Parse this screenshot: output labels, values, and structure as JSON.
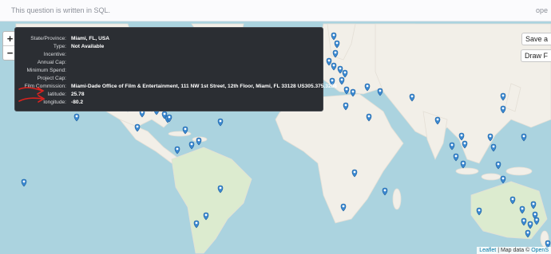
{
  "header": {
    "question_text": "This question is written in SQL.",
    "right_text": "ope"
  },
  "map": {
    "zoom_in_label": "+",
    "zoom_out_label": "−",
    "save_label": "Save a",
    "draw_label": "Draw F",
    "attribution": {
      "leaflet": "Leaflet",
      "separator": " | Map data © ",
      "osm": "OpenS"
    },
    "marker_color": "#3a88d1"
  },
  "tooltip": {
    "rows": [
      {
        "label": "State/Province:",
        "value": "Miami, FL, USA"
      },
      {
        "label": "Type:",
        "value": "Not Available"
      },
      {
        "label": "Incentive:",
        "value": ""
      },
      {
        "label": "Annual Cap:",
        "value": ""
      },
      {
        "label": "Minimum Spend:",
        "value": ""
      },
      {
        "label": "Project Cap:",
        "value": ""
      },
      {
        "label": "Film Commission:",
        "value": "Miami-Dade Office of Film & Entertainment, 111 NW 1st Street, 12th Floor, Miami, FL 33128 US305.375.3288"
      },
      {
        "label": "latitude:",
        "value": "25.78"
      },
      {
        "label": "longitude:",
        "value": "-80.2"
      }
    ]
  },
  "annotation_color": "#d9231f"
}
